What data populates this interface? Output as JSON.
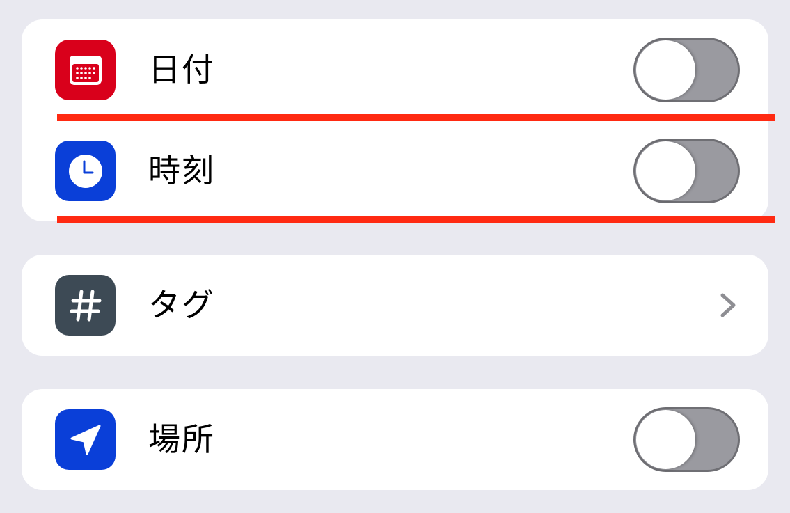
{
  "settings": {
    "date": {
      "label": "日付",
      "icon": "calendar-icon",
      "icon_color": "#d9001b",
      "enabled": false
    },
    "time": {
      "label": "時刻",
      "icon": "clock-icon",
      "icon_color": "#0a3fd8",
      "enabled": false
    },
    "tags": {
      "label": "タグ",
      "icon": "hashtag-icon",
      "icon_color": "#3d4a55"
    },
    "location": {
      "label": "場所",
      "icon": "location-arrow-icon",
      "icon_color": "#0a3fd8",
      "enabled": false
    }
  },
  "colors": {
    "background": "#e9e9f0",
    "card": "#ffffff",
    "toggle_off": "#9a9aa0",
    "highlight_line": "#ff2a12"
  }
}
